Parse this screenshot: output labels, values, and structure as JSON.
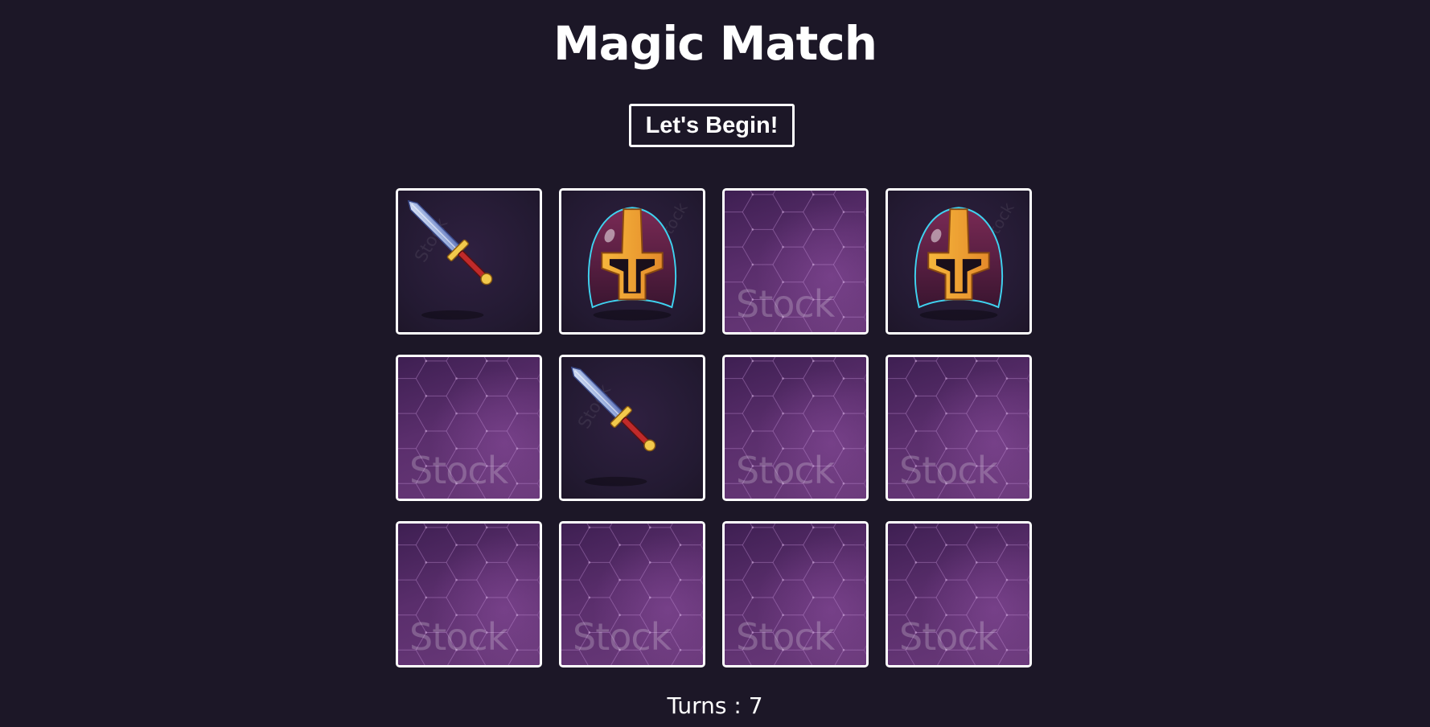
{
  "game": {
    "title": "Magic Match",
    "start_button_label": "Let's Begin!",
    "turns_label": "Turns :",
    "turns_value": "7"
  },
  "card_back": {
    "watermark_text": "Stock"
  },
  "cards": [
    {
      "state": "revealed",
      "icon": "sword-icon"
    },
    {
      "state": "revealed",
      "icon": "helmet-icon"
    },
    {
      "state": "hidden",
      "icon": "card-back"
    },
    {
      "state": "revealed",
      "icon": "helmet-icon"
    },
    {
      "state": "hidden",
      "icon": "card-back"
    },
    {
      "state": "revealed",
      "icon": "sword-icon"
    },
    {
      "state": "hidden",
      "icon": "card-back"
    },
    {
      "state": "hidden",
      "icon": "card-back"
    },
    {
      "state": "hidden",
      "icon": "card-back"
    },
    {
      "state": "hidden",
      "icon": "card-back"
    },
    {
      "state": "hidden",
      "icon": "card-back"
    },
    {
      "state": "hidden",
      "icon": "card-back"
    }
  ],
  "colors": {
    "background": "#1c1727",
    "text": "#ffffff",
    "card_border": "#ffffff",
    "card_back": "#5a2e6c"
  }
}
